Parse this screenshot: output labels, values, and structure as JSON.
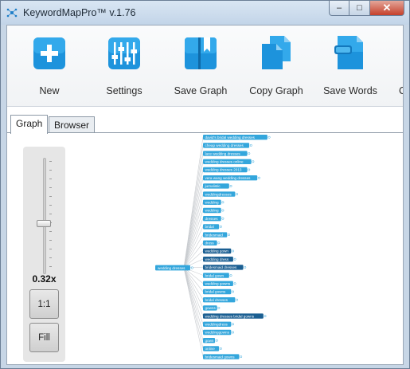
{
  "window": {
    "title": "KeywordMapPro™ v.1.76",
    "controls": {
      "minimize": "–",
      "maximize": "□",
      "close": "✕"
    }
  },
  "toolbar": {
    "items": [
      {
        "label": "New",
        "icon": "plus-icon"
      },
      {
        "label": "Settings",
        "icon": "sliders-icon"
      },
      {
        "label": "Save Graph",
        "icon": "book-bookmark-icon"
      },
      {
        "label": "Copy Graph",
        "icon": "copy-documents-icon"
      },
      {
        "label": "Save Words",
        "icon": "save-document-icon"
      }
    ]
  },
  "tabs": [
    {
      "label": "Graph",
      "active": true
    },
    {
      "label": "Browser",
      "active": false
    }
  ],
  "zoom": {
    "value_label": "0.32x",
    "level_fraction": 0.32,
    "reset_label": "1:1",
    "fill_label": "Fill"
  },
  "graph": {
    "root": "wedding dresses",
    "nodes": [
      "david's bridal wedding dresses",
      "cheap wedding dresses",
      "lace wedding dresses",
      "wedding dresses online",
      "wedding dresses 2013",
      "vera wang wedding dresses",
      "jurnalistic",
      "weddingdresses",
      "wedding",
      "wedding",
      "dresses",
      "bridal",
      "bridesmaid",
      "dress",
      "wedding gown",
      "wedding dress",
      "bridesmaid dresses",
      "bridal gown",
      "wedding gowns",
      "bridal gowns",
      "bridal dresses",
      "gowns",
      "wedding dresses bridal gowns",
      "weddingdress",
      "weddinggowns",
      "gown",
      "online",
      "bridesmaid gowns"
    ]
  },
  "colors": {
    "accent": "#1e8fd6",
    "node": "#33a6dc",
    "node_dark": "#1b5f92",
    "edge": "#c9ccd0"
  }
}
